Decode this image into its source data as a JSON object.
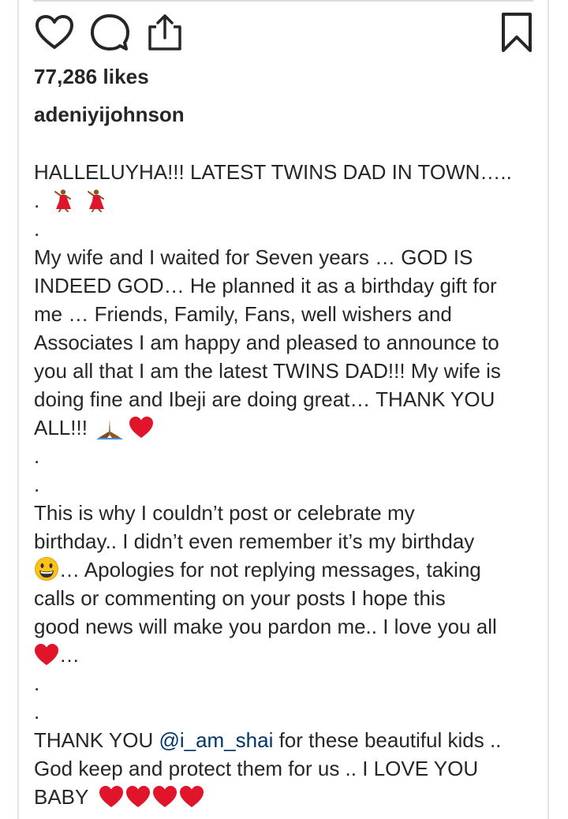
{
  "post": {
    "likes_text": "77,286 likes",
    "username": "adeniyijohnson"
  },
  "actions": {
    "like_icon": "heart-outline-icon",
    "comment_icon": "comment-bubble-icon",
    "share_icon": "share-upload-icon",
    "save_icon": "bookmark-outline-icon"
  },
  "caption": {
    "lines": [
      "HALLELUYHA!!! LATEST TWINS DAD IN TOWN…..",
      ".",
      ".",
      "My wife and I waited for Seven years … GOD IS",
      "INDEED GOD… He planned it as a birthday gift for",
      "me … Friends, Family, Fans, well wishers and",
      "Associates I am happy and pleased to announce to",
      "you all that I am the latest TWINS DAD!!! My wife is",
      "doing fine and Ibeji are doing great… THANK YOU",
      "ALL!!!",
      ".",
      ".",
      "This is why I couldn’t post or celebrate my",
      "birthday.. I didn’t even remember it’s my birthday",
      "… Apologies for not replying messages, taking",
      "calls or commenting on your posts I hope this",
      "good news will make you pardon me.. I love you all",
      "…",
      ".",
      ".",
      "THANK YOU ",
      "@i_am_shai",
      " for these beautiful kids ..",
      "God keep and protect them for us .. I LOVE YOU",
      "BABY"
    ]
  },
  "emojis": {
    "dancer": "dancing-woman-emoji",
    "pray": "folded-hands-emoji",
    "heart": "red-heart-emoji",
    "grin": "grinning-face-emoji"
  },
  "colors": {
    "text": "#262626",
    "mention": "#003569",
    "heart": "#e0142a",
    "border": "#e6e6e6"
  }
}
